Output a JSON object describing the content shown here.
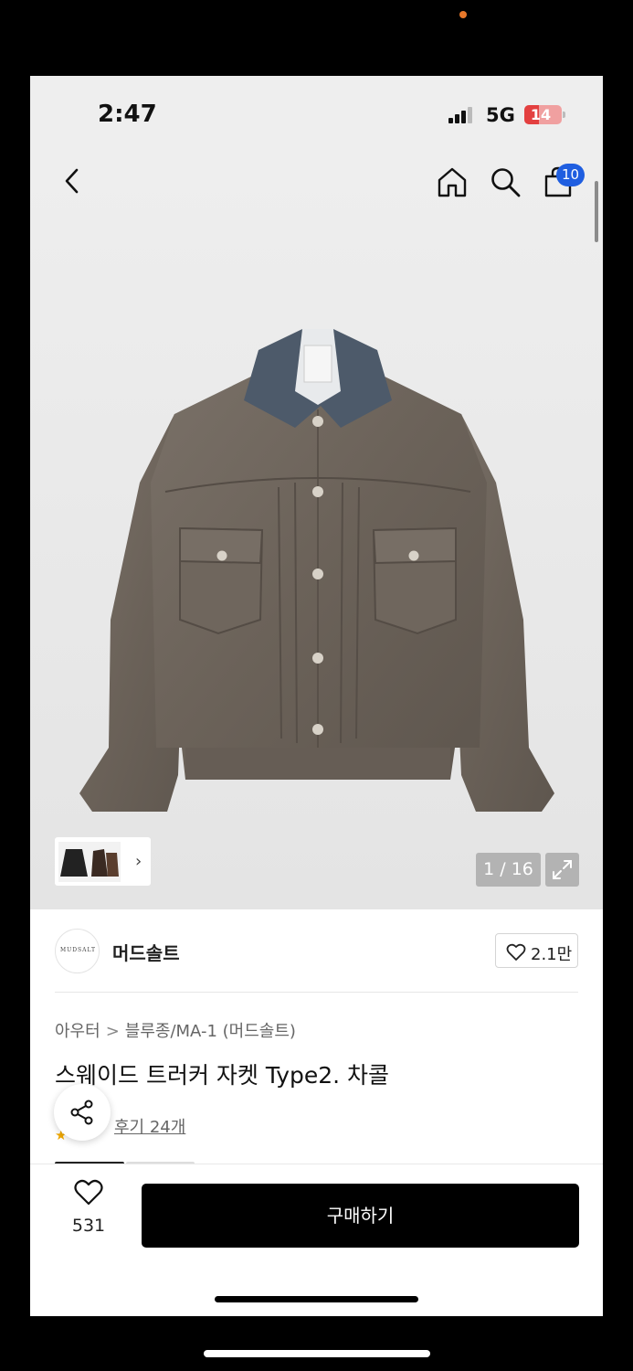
{
  "status_bar": {
    "time": "2:47",
    "network": "5G",
    "battery": "14"
  },
  "header": {
    "back_icon": "chevron-left-icon",
    "home_icon": "home-icon",
    "search_icon": "search-icon",
    "cart_icon": "shopping-bag-icon",
    "cart_count": "10"
  },
  "gallery": {
    "counter": "1 / 16",
    "expand_icon": "expand-icon",
    "thumb_more": "›"
  },
  "brand": {
    "logo_text": "MUDSALT",
    "name": "머드솔트",
    "likes": "2.1만"
  },
  "breadcrumb": {
    "category": "아우터",
    "separator": ">",
    "subcategory": "블루종/MA-1 (머드솔트)"
  },
  "product": {
    "title": "스웨이드 트러커 자켓 Type2. 차콜",
    "reviews": "후기 24개"
  },
  "bottom": {
    "wish_count": "531",
    "buy_label": "구매하기"
  },
  "colors": {
    "badge": "#1f5ee0",
    "buy_button": "#000000",
    "battery": "#e34040"
  }
}
